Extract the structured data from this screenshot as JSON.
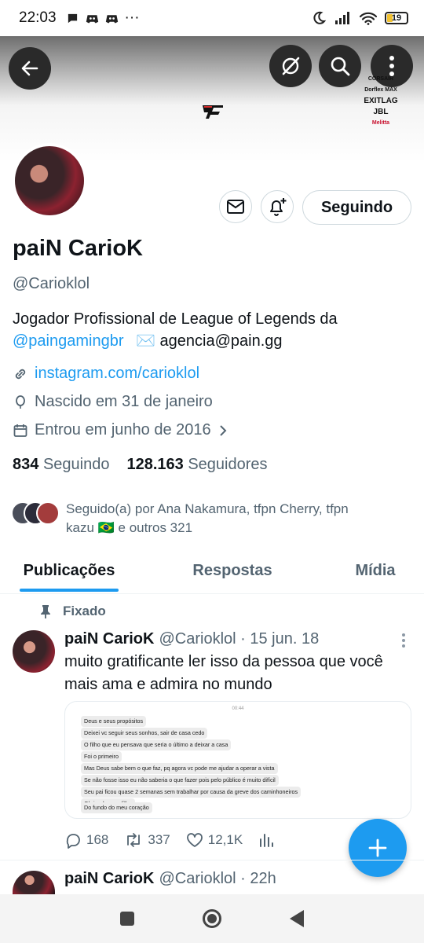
{
  "status_bar": {
    "time": "22:03",
    "dots": "···",
    "battery": "19"
  },
  "banner": {
    "sponsors": [
      "CORSAIR",
      "Dorflex MAX",
      "EXITLAG",
      "JBL",
      "Melitta"
    ]
  },
  "profile": {
    "follow_button": "Seguindo",
    "name": "paiN CarioK",
    "handle": "@Carioklol",
    "bio_line1": "Jogador Profissional de League of Legends da",
    "bio_mention": "@paingamingbr",
    "bio_email": "agencia@pain.gg",
    "link": "instagram.com/carioklol",
    "birthday": "Nascido em 31 de janeiro",
    "joined": "Entrou em junho de 2016",
    "following_count": "834",
    "following_label": "Seguindo",
    "followers_count": "128.163",
    "followers_label": "Seguidores",
    "followed_by": "Seguido(a) por Ana Nakamura, tfpn Cherry, tfpn kazu 🇧🇷 e outros 321"
  },
  "tabs": [
    "Publicações",
    "Respostas",
    "Mídia"
  ],
  "tweets": [
    {
      "pinned_label": "Fixado",
      "name": "paiN CarioK",
      "handle": "@Carioklol",
      "time": "· 15 jun. 18",
      "text": "muito gratificante ler isso da pessoa que você mais ama e admira no mundo",
      "media_time": "00:44",
      "media_messages": [
        "Deus e seus propósitos",
        "Deixei vc seguir seus sonhos, sair de casa cedo",
        "O filho que eu pensava que seria o último a deixar a casa",
        "Foi o primeiro",
        "Mas Deus sabe bem o que faz, pq agora vc pode me ajudar a operar a vista",
        "Se não fosse isso eu não saberia o que fazer pois pelo público é muito difícil",
        "Seu pai ficou quase 2 semanas sem trabalhar por causa da greve dos caminhoneiros",
        "Obrigada meu filho",
        "Do fundo do meu coração"
      ],
      "replies": "168",
      "retweets": "337",
      "likes": "12,1K"
    },
    {
      "name": "paiN CarioK",
      "handle": "@Carioklol",
      "time": "· 22h"
    }
  ],
  "colors": {
    "accent": "#1d9bf0",
    "text_primary": "#0f1419",
    "text_secondary": "#536471"
  }
}
